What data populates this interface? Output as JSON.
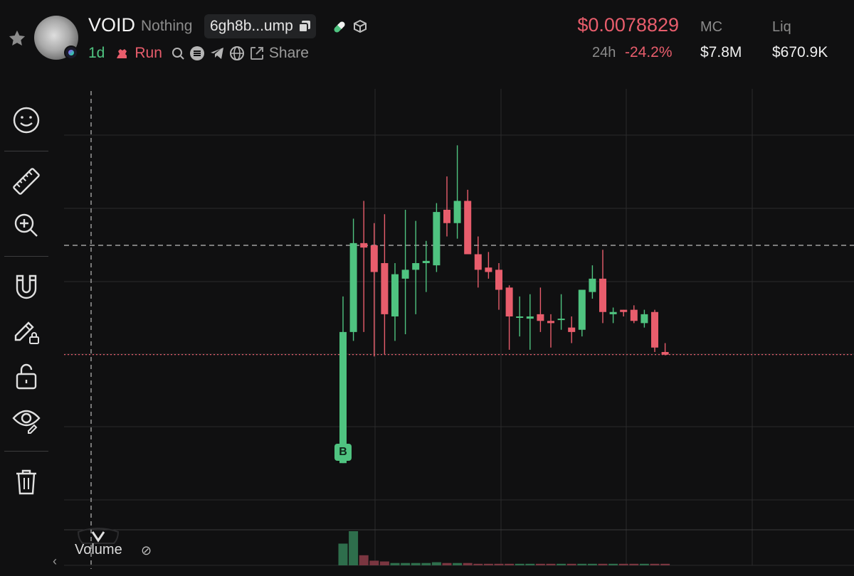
{
  "token": {
    "symbol": "VOID",
    "name": "Nothing",
    "address_short": "6gh8b...ump",
    "timeframe": "1d",
    "runner_label": "Run",
    "share_label": "Share"
  },
  "stats": {
    "price": "$0.0078829",
    "change_label": "24h",
    "change_value": "-24.2%",
    "mc_label": "MC",
    "mc_value": "$7.8M",
    "liq_label": "Liq",
    "liq_value": "$670.9K"
  },
  "colors": {
    "up": "#4fc380",
    "down": "#e85d6c",
    "grid": "#2a2a2c",
    "background": "#101011"
  },
  "toolbar": {
    "items": [
      "emoji-icon",
      "ruler-icon",
      "zoom-in-icon",
      "magnet-icon",
      "pencil-lock-icon",
      "lock-icon",
      "eye-icon",
      "trash-icon"
    ]
  },
  "volume": {
    "label": "Volume"
  },
  "marker": {
    "label": "B"
  },
  "chart_data": {
    "type": "candlestick",
    "candles": [
      {
        "o": 0.003,
        "h": 0.0105,
        "l": 0.003,
        "c": 0.0089
      },
      {
        "o": 0.0089,
        "h": 0.014,
        "l": 0.0085,
        "c": 0.0129
      },
      {
        "o": 0.0129,
        "h": 0.0148,
        "l": 0.0089,
        "c": 0.0127
      },
      {
        "o": 0.0128,
        "h": 0.0138,
        "l": 0.0078,
        "c": 0.0116
      },
      {
        "o": 0.012,
        "h": 0.0142,
        "l": 0.0079,
        "c": 0.0097
      },
      {
        "o": 0.0096,
        "h": 0.012,
        "l": 0.0085,
        "c": 0.0115
      },
      {
        "o": 0.0113,
        "h": 0.0144,
        "l": 0.0088,
        "c": 0.0117
      },
      {
        "o": 0.0117,
        "h": 0.0139,
        "l": 0.0097,
        "c": 0.012
      },
      {
        "o": 0.012,
        "h": 0.013,
        "l": 0.0107,
        "c": 0.0121
      },
      {
        "o": 0.0119,
        "h": 0.0147,
        "l": 0.0116,
        "c": 0.0143
      },
      {
        "o": 0.0144,
        "h": 0.0159,
        "l": 0.0132,
        "c": 0.0138
      },
      {
        "o": 0.0138,
        "h": 0.0173,
        "l": 0.0131,
        "c": 0.0148
      },
      {
        "o": 0.0148,
        "h": 0.0153,
        "l": 0.0124,
        "c": 0.0124
      },
      {
        "o": 0.0124,
        "h": 0.0132,
        "l": 0.0109,
        "c": 0.0117
      },
      {
        "o": 0.0118,
        "h": 0.0125,
        "l": 0.0113,
        "c": 0.0116
      },
      {
        "o": 0.0117,
        "h": 0.012,
        "l": 0.0099,
        "c": 0.0108
      },
      {
        "o": 0.0109,
        "h": 0.011,
        "l": 0.0081,
        "c": 0.0096
      },
      {
        "o": 0.0096,
        "h": 0.0105,
        "l": 0.0087,
        "c": 0.0096
      },
      {
        "o": 0.0095,
        "h": 0.0106,
        "l": 0.0081,
        "c": 0.0096
      },
      {
        "o": 0.0097,
        "h": 0.0109,
        "l": 0.0089,
        "c": 0.0094
      },
      {
        "o": 0.0094,
        "h": 0.0097,
        "l": 0.0082,
        "c": 0.0093
      },
      {
        "o": 0.0095,
        "h": 0.0106,
        "l": 0.009,
        "c": 0.0095
      },
      {
        "o": 0.0091,
        "h": 0.0096,
        "l": 0.0084,
        "c": 0.0089
      },
      {
        "o": 0.009,
        "h": 0.0108,
        "l": 0.0087,
        "c": 0.0108
      },
      {
        "o": 0.0107,
        "h": 0.0119,
        "l": 0.0104,
        "c": 0.0113
      },
      {
        "o": 0.0113,
        "h": 0.0126,
        "l": 0.0093,
        "c": 0.0098
      },
      {
        "o": 0.0097,
        "h": 0.01,
        "l": 0.0093,
        "c": 0.0098
      },
      {
        "o": 0.0099,
        "h": 0.0099,
        "l": 0.0096,
        "c": 0.0098
      },
      {
        "o": 0.0099,
        "h": 0.0101,
        "l": 0.0093,
        "c": 0.0094
      },
      {
        "o": 0.0093,
        "h": 0.0099,
        "l": 0.0091,
        "c": 0.0097
      },
      {
        "o": 0.0098,
        "h": 0.0099,
        "l": 0.008,
        "c": 0.0082
      },
      {
        "o": 0.008,
        "h": 0.0084,
        "l": 0.00785,
        "c": 0.00788
      }
    ],
    "volumes": [
      0.28,
      0.44,
      0.13,
      0.06,
      0.05,
      0.03,
      0.03,
      0.03,
      0.03,
      0.04,
      0.03,
      0.03,
      0.03,
      0.02,
      0.02,
      0.02,
      0.02,
      0.02,
      0.02,
      0.02,
      0.02,
      0.02,
      0.02,
      0.02,
      0.02,
      0.02,
      0.02,
      0.02,
      0.02,
      0.02,
      0.02,
      0.02
    ],
    "current_price": 0.0078829,
    "crosshair_price": 0.0128,
    "y_range": [
      0.0,
      0.02
    ],
    "grid": true
  }
}
